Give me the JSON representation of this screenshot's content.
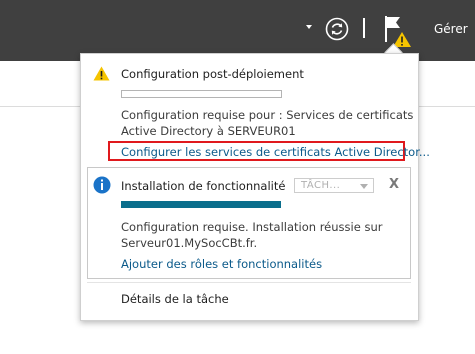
{
  "topbar": {
    "manage_label": "Gérer"
  },
  "notifications": [
    {
      "title": "Configuration post-déploiement",
      "progress_percent": 0,
      "message_line1": "Configuration requise pour : Services de certificats",
      "message_line2": "Active Directory à SERVEUR01",
      "link": "Configurer les services de certificats Active Director..."
    },
    {
      "title": "Installation de fonctionnalité",
      "progress_percent": 100,
      "task_dropdown": "TÂCH...",
      "close_label": "X",
      "message_line1": "Configuration requise. Installation réussie sur",
      "message_line2": "Serveur01.MySocCBt.fr.",
      "link": "Ajouter des rôles et fonctionnalités"
    }
  ],
  "footer_link": "Détails de la tâche",
  "colors": {
    "topbar": "#404040",
    "warning": "#f5c400",
    "info": "#1a73c8",
    "link": "#0b5a8a",
    "highlight": "#e0191d",
    "progress_fill": "#0a6e8c"
  },
  "icons": {
    "refresh": "refresh-icon",
    "flag": "notification-flag-icon",
    "warning": "warning-icon",
    "info": "info-icon"
  }
}
